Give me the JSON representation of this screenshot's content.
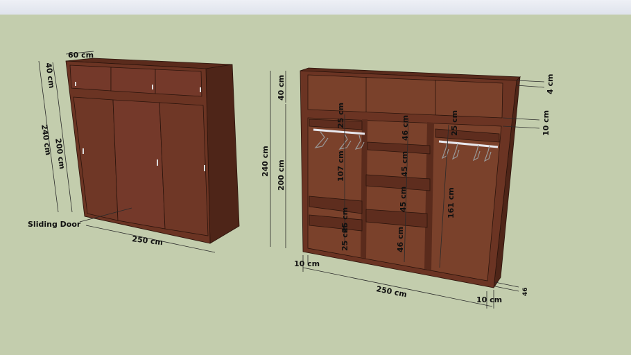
{
  "scene": {
    "colors": {
      "background": "#c3cdad",
      "wood_front": "#6b3423",
      "wood_side": "#4e2518",
      "wood_inner": "#7a412b",
      "rail": "#e8e8ee"
    },
    "left_wardrobe": {
      "labels": {
        "depth": "60 cm",
        "top_height": "40 cm",
        "total_height": "240 cm",
        "door_height": "200 cm",
        "width": "250 cm",
        "door_label": "Sliding Door"
      }
    },
    "right_wardrobe": {
      "labels": {
        "total_height": "240 cm",
        "top_height": "40 cm",
        "lower_height": "200 cm",
        "top_panel": "4 cm",
        "divider": "10 cm",
        "rail_gap_left": "25 cm",
        "rail_gap_right": "25 cm",
        "left_hanging": "107 cm",
        "left_shelf_1": "25 cm",
        "left_shelf_2": "25 cm",
        "mid_1": "46 cm",
        "mid_2": "45 cm",
        "mid_3": "45 cm",
        "mid_4": "46 cm",
        "right_hanging": "161 cm",
        "side_left": "10 cm",
        "width": "250 cm",
        "side_right": "10 cm",
        "base": "46"
      }
    }
  }
}
